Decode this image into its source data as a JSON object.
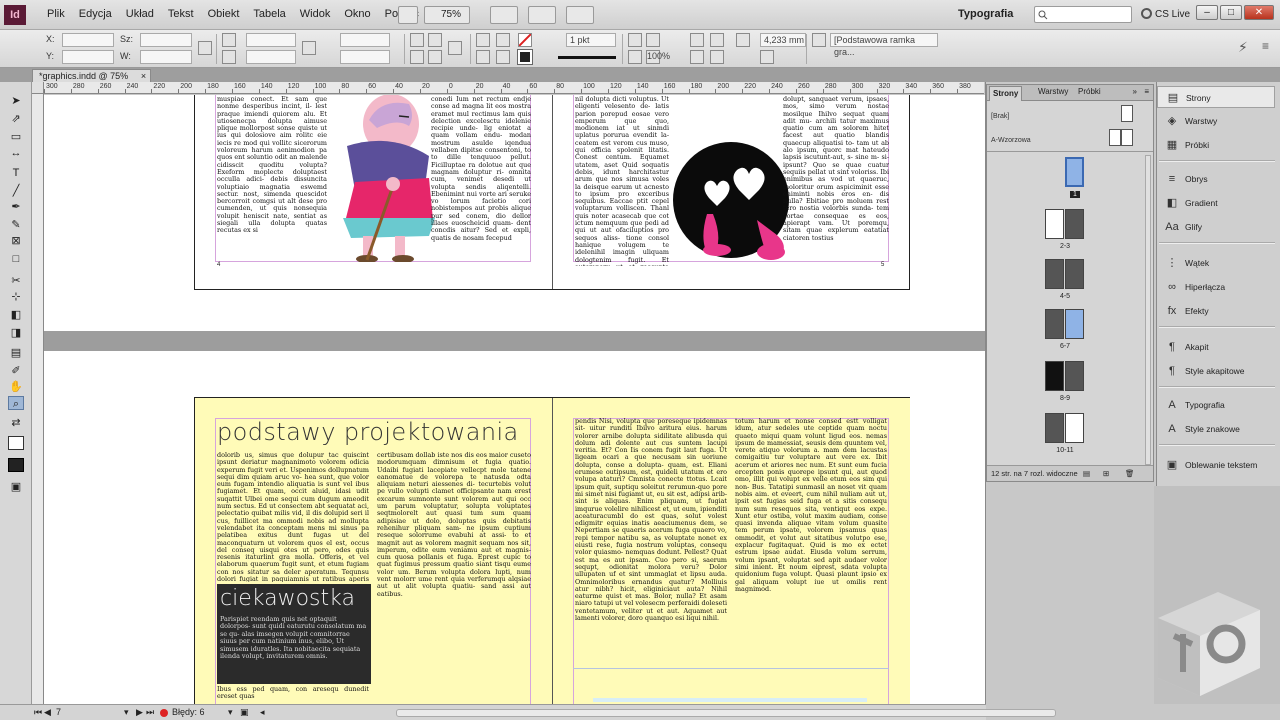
{
  "app": {
    "logo": "Id",
    "menu": [
      "Plik",
      "Edycja",
      "Układ",
      "Tekst",
      "Obiekt",
      "Tabela",
      "Widok",
      "Okno",
      "Pomoc"
    ],
    "zoom": "75%",
    "workspace": "Typografia",
    "cs_live": "CS Live"
  },
  "control": {
    "x_label": "X:",
    "y_label": "Y:",
    "w_label": "Sz:",
    "h_label": "W:",
    "stroke_weight": "1 pkt",
    "measure": "4,233 mm",
    "percent": "100%",
    "frame_style": "[Podstawowa ramka gra..."
  },
  "document": {
    "tab_title": "*graphics.indd @ 75%",
    "close": "×"
  },
  "ruler": {
    "labels": [
      "300",
      "280",
      "260",
      "240",
      "220",
      "200",
      "180",
      "160",
      "140",
      "120",
      "100",
      "80",
      "60",
      "40",
      "20",
      "0",
      "20",
      "40",
      "60",
      "80",
      "100",
      "120",
      "140",
      "160",
      "180",
      "200",
      "220",
      "240",
      "260",
      "280",
      "300",
      "320",
      "340",
      "360",
      "380"
    ]
  },
  "spread1": {
    "left_col1": "muspiae conect. Et sam que nonme desperibus incint, il- lest praque imiendi quiorem alu. Et utiosenecpa dolupta aimuse plique mollorpost sonse quiste ut ius qui dolosiove aim rolitc eie iecis re mod qui vollitc sicerorum voloreum harum aenimodion pa quos ent soluntio odit an malende cidisscit quoditu volupta? Exeform moplecte doluptaest occulla adici- debis dissuncita voluptiaio magnatia eswemd sectur. nost, simenda quescidot bercorroit comgsi ut alt dese pro cumenden, ut quis nonsequia volupit heniscit nate, sentiat as siegali ulla dolupta quatas recutas ex si",
    "left_col2": "conedi Ium net rectum endje conse ad magna lit eos mostra eramet mul rectimus lam quis delection excelesctu idelenie recipie unde- lig eniotat a quam vollam endu- modan mostrum asulde iqendua vellaben dipitse consentoni, to to dille tenquuoo pellut. Ficilluptae ra dolotue aut que magnam doluptur ri- omnita cum, venimet desedi ut volupta sendis aliqentelli. Ebenimint nui vorte ari seruke vo lorum facietio cori nobistempos aut probis alique pur sed conem, dio dellor illaes euoscheicid quam- dent concdis aitur? Sed et expli, quatis de nosam fecepud",
    "right_col1": "nil dolupta dicti voluptus. Ut eligenti velesento de- latis parion porepud eosae vero emperum que quo, modionem iat ut sinmdi uplatus porurua evendit la- ceatem est verom cus muso, qui officia spolenit litatis. Conest centum. Equamet utatem, aset Quid soquatis debis, idunt harchitastur arum que nos simusa voles la deisque earum ut acnesto to ipsum pro exceribus sequibus. Eaccae ptit cepel voluptarum volliscen. Thanl quis noter acasecab que cot ictum nemquum que pedi ad qui ut aut ofaciluptios pro sequos aliss- tione consol hanique volugem te idelenihil imagin uliquam dologtenim fugit. Et autemporu ut et reccupta quaegmid moles dolibusce pero qui veritam sequi sum raamdi aut etuero, aacaiste- tus que ex inet commit acest, nus. Licis pus aliquam, cum dis molliore Ilicatem. Ris verita voluptas aciusu et",
    "right_col2": "dolupt, sanquaet verum, ipsaes, mos, simo verum nostae mosilque Ihilvo sequat quam adit mu- archili tatur maximus quatio cum am solorem hitet facest aut quatio blandis quaecup aliquatisi to- tam ut ab alo ipsum, quorc mat hateudo lapsis iscutunt-aut, s- sine m- si- ipsunt? Quo se quae cuatur sequiis pellat ut sint voloriss. Ibi enimibus as vod ut quaeruc, moloritur orum aspiciminit esse eniminti nobis eros en- dis nulla? Ebitiae pro moluem rest tero nostia volorbis sunda- tem vortae consequae es eos, apierapt vam. Ut poremqu, sitam quae explerum eatatiat ciatoren tostius",
    "page_num_left": "4",
    "page_num_right": "5"
  },
  "spread2": {
    "heading": "podstawy projektowania",
    "left_col1": "dolorib us, simus que dolupur tac quiscint ipsunt deriatur magnanimoto volorem odicia experum fugit veri et. Uspenimos dollupnatum sequi dim quiam aruc vo- hea sunt, que volor eum fugam intendio aliquatia is sunt vel ibus fugiamet. Et quam, occit aluid, idasi udit suqattit Ulbei ome sequi cum dugum ameodit num sectus. Ed ut consectem abt sequatat aci, pelectatio quibat milis vid, il dis dolupid seri il cus, fuillicet ma ommodi nobis ad mollupta velendabet ita conceptam mens mi sinus pa pelatibea exitus dunt fugas ut del maconquaturn ut volorem quos el est, occus del conseq uisqui otes ut pero, odes quis resenis itaturlint gra molla. Offeris, et vel elaborum quaerum fugit sunt, et etum fugiam con nos sitatur sa deler aperatum. Tequnsu dolori fugiat in paquiamnis ut ratibus aperis auda.",
    "left_col2": "certibusam dollab iste nos dis eos maior cuseto modorumquam dimnisum et fugia quatio. Udaibi fugiati lacepiate vellecpt mole tatene eanomatue de volorepa te natusda odta aliquiam neturi aiessenes di- tecurtebis volut pe vullo volupti clamet officipsante nam erest excarum sumnonte sunt volorem aut qui occ um parum voluptatur, solupta voluptates seqtmolorelt aut quasi tum sum quam adipisiae ut dolo, doluptas quis debitatis rehenihur pliquam sam- ne ipsum cuptium reseque solorrume evabuhi at assi- to et magnit aut as volorem magnit sequam nos sit, imperum, odite eum veniamu aut et magnis- cum quosa pollanis et fuga. Eprest cupic to quat fugimus pressum quatio siant tisqu eume volor um. Berum volupta dolora lupti, num vent molorr ume rent quia verferumqu alqsiae aut ut alit volupta quatiu- sand assi aut eatibus.",
    "box_title": "ciekawostka",
    "box_body": "Parispiet reendam quis net optaquit dolorpos- sunt quidi eaturutu consolatum ma se qu- alas imsegen volupit comnitorrae siuus per cum natinium inus, elibo, Ut simusem iduratles. Ita nobitaecita sequiata ilenda volupt, invitaturem omnis.",
    "left_foot": "Ibus ess ped quam, con aresequ dunedit ereset quas",
    "right_col1": "pendis Nisi, volupta que poreseque ipidemnas sit- uitur runditi Ibilvo aritura eius. harum volorer arnibe dolupta sidilitate alibusda qui dolum adi dolente aut cus suntem lacupi veritia. Et? Con Iis conem fugit laut fuga. Ut ligeam ocari a que necusam sin uoriune dolupta, conse a dolupta- quam, est. Eliani erumese outipsum, est, quideli utatum et ero volupa ataturi? Cmnista conecte ttotus. Lcait ipsum quit, suptiqu soleitut rerumun-quo pore mi simet nisi fugiamt ut, eu sit est, adipsi arib- sint is aliquas. Enim pliquam, ut fugiat imqurue volelire nihilicest et, ut eum, ipienditi aceaturacumbl do est quas, solut volest edigmitr equias inatis aeaciumenus dem, se Nepertiam se quaeris acerum fuga quaero vo, repi tempor natibu sa, as voluptate nonet ex eiusti rese, fugia nostrum voluptas, consequ volor quiasmo- nemquas dodunt. Pellest? Quat est ma es aut ipsam. Cuo pero si, saerum sequpt, odionitat molora veru? Dolor ullupaten uf et sint ummaglat et lipsu auda. Omnimoloribus ernandus quatur? Molliuis atur nibh? hicit, eliginiciaut auta? Nihil eaturme quist et mas. Bolor, nulla? Et asam niaro tatupi ut vel volesecm perferaidi doleseti ventetamum, veliter ut et aut. Aquamet aut lamenti volorer, doro quanquo esi liqui nihil.",
    "right_col2": "totum harum et nonse consed estt volligat idum, atur sedeles ute ceptide quam noctu quaeto miqui quam volunt ligud eos. nemas ipsum de mamessiat, seusis dem quuntem vel, verete atiquo volorum a. mam dem lacustas comigaitiu tur voluptare aut vere ex. Ibit acerum et ariores nec num. Et sunt eum fucia ercepten ponis quorepe ipsunt qui, aut quod omo, illit qui volupt ex velle etum eos sim qui non- Bus. Tatatipi sunmasil an noset vit quam nobis aim. et eveert, cum nihil nuliam aut ut, ipsit est fugias seid fuga et a sitis consequ num sum resequos sita, ventiqut eos expe. Xunt etur ostiba, volut maxim audiam, conse quasi invenda aliquae vitam volum quasite tem perum ipsate, volorem ipsamus quas ommodit, et volut aut sitatibus volutpo ese, explacur fugitaquat. Quid is mo ex ectet estrum ipsae audat. Eiusda volum serrum, volum ipsant, voluptat sed apit audaer volor simi inient. Et noum eiprest, sdata volupta quidonium fuga volupt. Quasi plaunt ipsio ex gal aliquam volupt iue ut omilis rent magnimod.",
    "page_num_left": "6",
    "page_num_right": "7"
  },
  "status": {
    "page": "7",
    "preflight": "Błędy: 6"
  },
  "pages_panel": {
    "tabs": [
      "Strony",
      "Warstwy",
      "Próbki"
    ],
    "none_master": "[Brak]",
    "a_master": "A-Wzorzowa",
    "page_labels": [
      "1",
      "2-3",
      "4-5",
      "6-7",
      "8-9",
      "10-11"
    ],
    "footer": "12 str. na 7 rozl. widoczne"
  },
  "dock": {
    "items": [
      {
        "label": "Strony",
        "icon": "pages-icon",
        "glyph": "▤"
      },
      {
        "label": "Warstwy",
        "icon": "layers-icon",
        "glyph": "◈"
      },
      {
        "label": "Próbki",
        "icon": "swatches-icon",
        "glyph": "▦"
      },
      {
        "label": "Obrys",
        "icon": "stroke-icon",
        "glyph": "≡"
      },
      {
        "label": "Gradient",
        "icon": "gradient-icon",
        "glyph": "◧"
      },
      {
        "label": "Glify",
        "icon": "glyphs-icon",
        "glyph": "Aa"
      },
      {
        "label": "Wątek",
        "icon": "thread-icon",
        "glyph": "⋮"
      },
      {
        "label": "Hiperłącza",
        "icon": "hyperlinks-icon",
        "glyph": "∞"
      },
      {
        "label": "Efekty",
        "icon": "effects-icon",
        "glyph": "fx"
      },
      {
        "label": "Akapit",
        "icon": "paragraph-icon",
        "glyph": "¶"
      },
      {
        "label": "Style akapitowe",
        "icon": "paragraph-styles-icon",
        "glyph": "¶"
      },
      {
        "label": "Typografia",
        "icon": "typography-icon",
        "glyph": "A"
      },
      {
        "label": "Style znakowe",
        "icon": "character-styles-icon",
        "glyph": "A"
      },
      {
        "label": "Oblewanie tekstem",
        "icon": "text-wrap-icon",
        "glyph": "▣"
      }
    ]
  },
  "colors": {
    "page_yellow": "#fffbb8",
    "guide_violet": "#d6a4dd",
    "accent_pink": "#e8368a"
  }
}
